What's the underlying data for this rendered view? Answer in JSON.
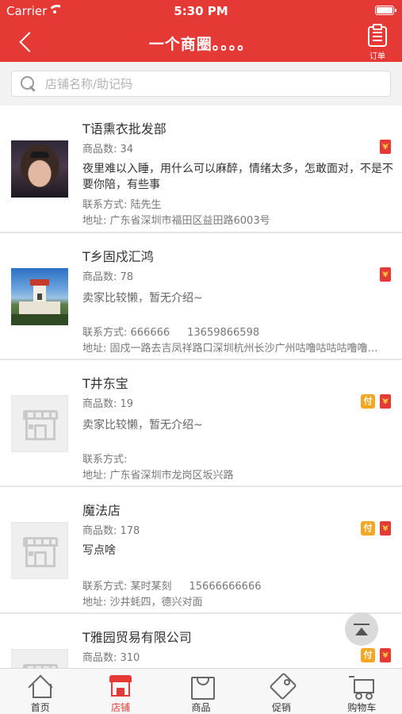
{
  "status_bar": {
    "carrier": "Carrier",
    "time": "5:30 PM"
  },
  "nav": {
    "title": "一个商圈。。。。",
    "order_label": "订单"
  },
  "search": {
    "placeholder": "店铺名称/助记码"
  },
  "shops": [
    {
      "name": "T语熏衣批发部",
      "count": "商品数: 34",
      "description": "夜里难以入睡，用什么可以麻醉，情绪太多，怎敢面对，不是不要你陪，有些事",
      "contact": "联系方式: 陆先生",
      "phone2": "",
      "address": "地址: 广东省深圳市福田区益田路6003号",
      "image": "photo",
      "badges": [
        "red-envelope"
      ]
    },
    {
      "name": "T乡固戍汇鸿",
      "count": "商品数: 78",
      "description": "卖家比较懒，暂无介绍~",
      "contact": "联系方式: 666666",
      "phone2": "13659866598",
      "address": "地址: 固戍一路去吉凤祥路口深圳杭州长沙广州咕噜咕咕咕噜噜…",
      "image": "photo",
      "badges": [
        "red-envelope"
      ]
    },
    {
      "name": "T井东宝",
      "count": "商品数: 19",
      "description": "卖家比较懒，暂无介绍~",
      "contact": "联系方式:",
      "phone2": "",
      "address": "地址: 广东省深圳市龙岗区坂兴路",
      "image": "placeholder",
      "badges": [
        "pay",
        "red-envelope"
      ]
    },
    {
      "name": "魔法店",
      "count": "商品数: 178",
      "description": "写点啥",
      "contact": "联系方式: 某时某刻",
      "phone2": "15666666666",
      "address": "地址: 沙井蚝四，德兴对面",
      "image": "placeholder",
      "badges": [
        "pay",
        "red-envelope"
      ]
    },
    {
      "name": "T雅园贸易有限公司",
      "count": "商品数: 310",
      "description": "",
      "contact": "",
      "phone2": "",
      "address": "",
      "image": "placeholder",
      "badges": [
        "pay",
        "red-envelope"
      ]
    }
  ],
  "pay_badge_label": "付",
  "tabs": [
    {
      "label": "首页",
      "icon": "home-icon",
      "active": false
    },
    {
      "label": "店铺",
      "icon": "shop-icon",
      "active": true
    },
    {
      "label": "商品",
      "icon": "bag-icon",
      "active": false
    },
    {
      "label": "促销",
      "icon": "tag-icon",
      "active": false
    },
    {
      "label": "购物车",
      "icon": "cart-icon",
      "active": false
    }
  ],
  "colors": {
    "brand": "#e53935",
    "pay_badge": "#f5a623",
    "active_tab": "#e53935"
  }
}
